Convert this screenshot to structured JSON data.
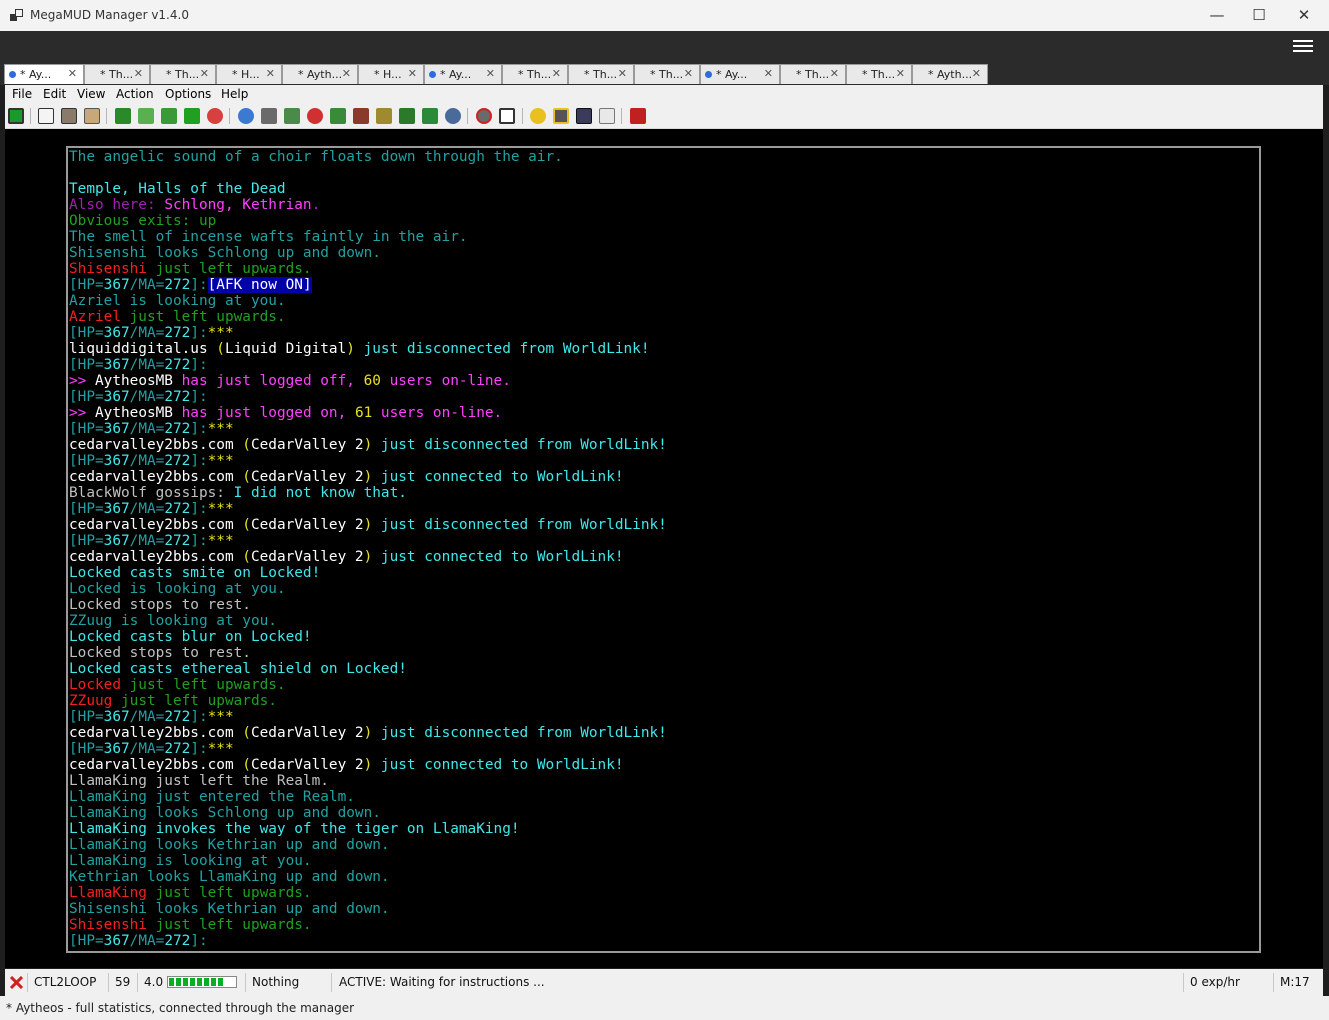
{
  "window": {
    "title": "MegaMUD Manager v1.4.0",
    "minimize": "—",
    "maximize": "☐",
    "close": "✕"
  },
  "tabs": [
    {
      "label": "* Ay...",
      "dot": true
    },
    {
      "label": "* Th...",
      "dot": false
    },
    {
      "label": "* Th...",
      "dot": false
    },
    {
      "label": "* H...",
      "dot": false
    },
    {
      "label": "* Ayth...",
      "dot": false
    },
    {
      "label": "* H...",
      "dot": false
    },
    {
      "label": "* Ay...",
      "dot": true
    },
    {
      "label": "* Th...",
      "dot": false
    },
    {
      "label": "* Th...",
      "dot": false
    },
    {
      "label": "* Th...",
      "dot": false
    },
    {
      "label": "* Ay...",
      "dot": true
    },
    {
      "label": "* Th...",
      "dot": false
    },
    {
      "label": "* Th...",
      "dot": false
    },
    {
      "label": "* Ayth...",
      "dot": false
    }
  ],
  "menu": [
    "File",
    "Edit",
    "View",
    "Action",
    "Options",
    "Help"
  ],
  "toolbar_icons": [
    "connect-icon",
    "copy-icon",
    "paste-icon",
    "log-icon",
    "go-icon",
    "loop-icon",
    "map-icon",
    "undo-icon",
    "stop-icon",
    "lightbulb-icon",
    "sword-icon",
    "sneak-icon",
    "heart-icon",
    "party-icon",
    "box-icon",
    "items-icon",
    "tree-icon",
    "trees-icon",
    "search-icon",
    "no-icon",
    "chat-icon",
    "settings-icon",
    "settings2-icon",
    "sound-icon",
    "stats-icon",
    "book-icon"
  ],
  "terminal": {
    "lines": [
      [
        [
          "dc",
          "The angelic sound of a choir floats down through the air."
        ]
      ],
      [],
      [
        [
          "bc",
          "Temple, Halls of the Dead"
        ]
      ],
      [
        [
          "dm",
          "Also here: "
        ],
        [
          "bm",
          "Schlong, Kethrian"
        ],
        [
          "dm",
          "."
        ]
      ],
      [
        [
          "dg",
          "Obvious exits: up"
        ]
      ],
      [
        [
          "dc",
          "The smell of incense wafts faintly in the air."
        ]
      ],
      [
        [
          "dc",
          "Shisenshi looks Schlong up and down."
        ]
      ],
      [
        [
          "br",
          "Shisenshi"
        ],
        [
          "dg",
          " just left upwards."
        ]
      ],
      [
        [
          "dc",
          "[HP="
        ],
        [
          "bc",
          "367"
        ],
        [
          "dc",
          "/MA="
        ],
        [
          "bc",
          "272"
        ],
        [
          "dc",
          "]:"
        ],
        [
          "hl",
          "[AFK now ON]"
        ]
      ],
      [
        [
          "dc",
          "Azriel is looking at you."
        ]
      ],
      [
        [
          "br",
          "Azriel"
        ],
        [
          "dg",
          " just left upwards."
        ]
      ],
      [
        [
          "dc",
          "[HP="
        ],
        [
          "bc",
          "367"
        ],
        [
          "dc",
          "/MA="
        ],
        [
          "bc",
          "272"
        ],
        [
          "dc",
          "]:"
        ],
        [
          "y",
          "***"
        ]
      ],
      [
        [
          "w",
          "liquiddigital.us "
        ],
        [
          "y",
          "("
        ],
        [
          "w",
          "Liquid Digital"
        ],
        [
          "y",
          ")"
        ],
        [
          "bc",
          " just disconnected from WorldLink!"
        ]
      ],
      [
        [
          "dc",
          "[HP="
        ],
        [
          "bc",
          "367"
        ],
        [
          "dc",
          "/MA="
        ],
        [
          "bc",
          "272"
        ],
        [
          "dc",
          "]:"
        ]
      ],
      [
        [
          "bm",
          ">> "
        ],
        [
          "w",
          "AytheosMB"
        ],
        [
          "bm",
          " has just logged off, "
        ],
        [
          "y",
          "60"
        ],
        [
          "bm",
          " users on-line."
        ]
      ],
      [
        [
          "dc",
          "[HP="
        ],
        [
          "bc",
          "367"
        ],
        [
          "dc",
          "/MA="
        ],
        [
          "bc",
          "272"
        ],
        [
          "dc",
          "]:"
        ]
      ],
      [
        [
          "bm",
          ">> "
        ],
        [
          "w",
          "AytheosMB"
        ],
        [
          "bm",
          " has just logged on, "
        ],
        [
          "y",
          "61"
        ],
        [
          "bm",
          " users on-line."
        ]
      ],
      [
        [
          "dc",
          "[HP="
        ],
        [
          "bc",
          "367"
        ],
        [
          "dc",
          "/MA="
        ],
        [
          "bc",
          "272"
        ],
        [
          "dc",
          "]:"
        ],
        [
          "y",
          "***"
        ]
      ],
      [
        [
          "w",
          "cedarvalley2bbs.com "
        ],
        [
          "y",
          "("
        ],
        [
          "w",
          "CedarValley 2"
        ],
        [
          "y",
          ")"
        ],
        [
          "bc",
          " just disconnected from WorldLink!"
        ]
      ],
      [
        [
          "dc",
          "[HP="
        ],
        [
          "bc",
          "367"
        ],
        [
          "dc",
          "/MA="
        ],
        [
          "bc",
          "272"
        ],
        [
          "dc",
          "]:"
        ],
        [
          "y",
          "***"
        ]
      ],
      [
        [
          "w",
          "cedarvalley2bbs.com "
        ],
        [
          "y",
          "("
        ],
        [
          "w",
          "CedarValley 2"
        ],
        [
          "y",
          ")"
        ],
        [
          "bc",
          " just connected to WorldLink!"
        ]
      ],
      [
        [
          "g",
          "BlackWolf gossips: "
        ],
        [
          "bc",
          "I did not know that."
        ]
      ],
      [
        [
          "dc",
          "[HP="
        ],
        [
          "bc",
          "367"
        ],
        [
          "dc",
          "/MA="
        ],
        [
          "bc",
          "272"
        ],
        [
          "dc",
          "]:"
        ],
        [
          "y",
          "***"
        ]
      ],
      [
        [
          "w",
          "cedarvalley2bbs.com "
        ],
        [
          "y",
          "("
        ],
        [
          "w",
          "CedarValley 2"
        ],
        [
          "y",
          ")"
        ],
        [
          "bc",
          " just disconnected from WorldLink!"
        ]
      ],
      [
        [
          "dc",
          "[HP="
        ],
        [
          "bc",
          "367"
        ],
        [
          "dc",
          "/MA="
        ],
        [
          "bc",
          "272"
        ],
        [
          "dc",
          "]:"
        ],
        [
          "y",
          "***"
        ]
      ],
      [
        [
          "w",
          "cedarvalley2bbs.com "
        ],
        [
          "y",
          "("
        ],
        [
          "w",
          "CedarValley 2"
        ],
        [
          "y",
          ")"
        ],
        [
          "bc",
          " just connected to WorldLink!"
        ]
      ],
      [
        [
          "bc",
          "Locked casts smite on Locked!"
        ]
      ],
      [
        [
          "dc",
          "Locked is looking at you."
        ]
      ],
      [
        [
          "g",
          "Locked stops to rest."
        ]
      ],
      [
        [
          "dc",
          "ZZuug is looking at you."
        ]
      ],
      [
        [
          "bc",
          "Locked casts blur on Locked!"
        ]
      ],
      [
        [
          "g",
          "Locked stops to rest."
        ]
      ],
      [
        [
          "bc",
          "Locked casts ethereal shield on Locked!"
        ]
      ],
      [
        [
          "br",
          "Locked"
        ],
        [
          "dg",
          " just left upwards."
        ]
      ],
      [
        [
          "br",
          "ZZuug"
        ],
        [
          "dg",
          " just left upwards."
        ]
      ],
      [
        [
          "dc",
          "[HP="
        ],
        [
          "bc",
          "367"
        ],
        [
          "dc",
          "/MA="
        ],
        [
          "bc",
          "272"
        ],
        [
          "dc",
          "]:"
        ],
        [
          "y",
          "***"
        ]
      ],
      [
        [
          "w",
          "cedarvalley2bbs.com "
        ],
        [
          "y",
          "("
        ],
        [
          "w",
          "CedarValley 2"
        ],
        [
          "y",
          ")"
        ],
        [
          "bc",
          " just disconnected from WorldLink!"
        ]
      ],
      [
        [
          "dc",
          "[HP="
        ],
        [
          "bc",
          "367"
        ],
        [
          "dc",
          "/MA="
        ],
        [
          "bc",
          "272"
        ],
        [
          "dc",
          "]:"
        ],
        [
          "y",
          "***"
        ]
      ],
      [
        [
          "w",
          "cedarvalley2bbs.com "
        ],
        [
          "y",
          "("
        ],
        [
          "w",
          "CedarValley 2"
        ],
        [
          "y",
          ")"
        ],
        [
          "bc",
          " just connected to WorldLink!"
        ]
      ],
      [
        [
          "g",
          "LlamaKing just left the Realm."
        ]
      ],
      [
        [
          "dc",
          "LlamaKing just entered the Realm."
        ]
      ],
      [
        [
          "dc",
          "LlamaKing looks Schlong up and down."
        ]
      ],
      [
        [
          "bc",
          "LlamaKing invokes the way of the tiger on LlamaKing!"
        ]
      ],
      [
        [
          "dc",
          "LlamaKing looks Kethrian up and down."
        ]
      ],
      [
        [
          "dc",
          "LlamaKing is looking at you."
        ]
      ],
      [
        [
          "dc",
          "Kethrian looks LlamaKing up and down."
        ]
      ],
      [
        [
          "br",
          "LlamaKing"
        ],
        [
          "dg",
          " just left upwards."
        ]
      ],
      [
        [
          "dc",
          "Shisenshi looks Kethrian up and down."
        ]
      ],
      [
        [
          "br",
          "Shisenshi"
        ],
        [
          "dg",
          " just left upwards."
        ]
      ],
      [
        [
          "dc",
          "[HP="
        ],
        [
          "bc",
          "367"
        ],
        [
          "dc",
          "/MA="
        ],
        [
          "bc",
          "272"
        ],
        [
          "dc",
          "]:"
        ]
      ]
    ]
  },
  "status": {
    "mode": "CTL2LOOP",
    "number": "59",
    "version": "4.0",
    "progress_fraction": 0.85,
    "target": "Nothing",
    "activity": "ACTIVE: Waiting for instructions ...",
    "exp_rate": "0 exp/hr",
    "timer": "M:17"
  },
  "bottom_status": "* Aytheos  -  full statistics, connected through the manager"
}
